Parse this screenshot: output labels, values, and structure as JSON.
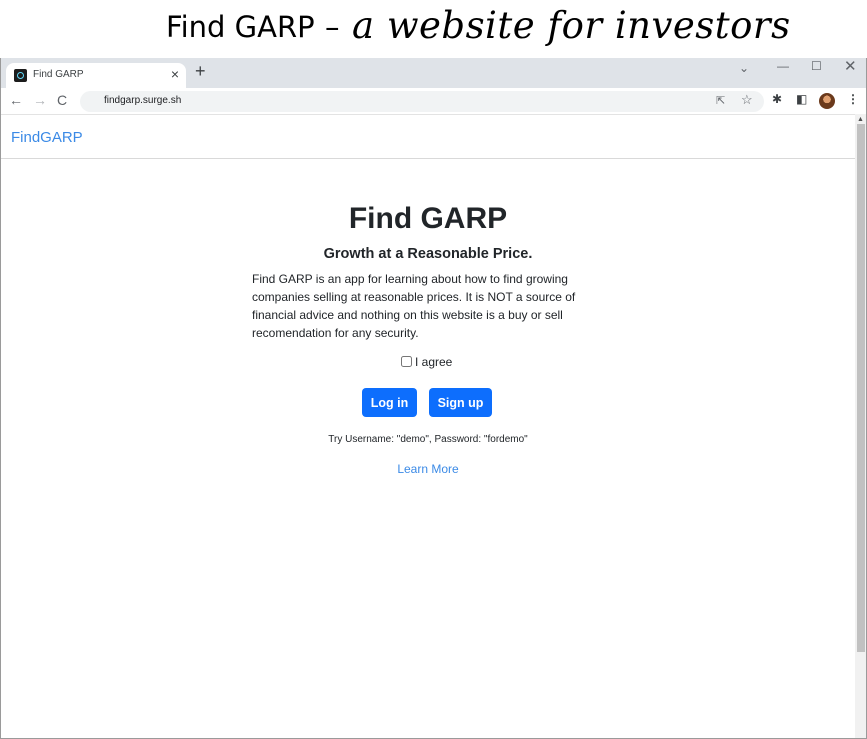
{
  "caption": {
    "plain": "Find GARP",
    "dash": "–",
    "italic": "a website for investors"
  },
  "browser": {
    "tab_title": "Find GARP",
    "tab_close": "×",
    "new_tab": "+",
    "url": "findgarp.surge.sh",
    "icons": {
      "back": "←",
      "forward": "→",
      "reload": "C",
      "share": "⇱",
      "star": "☆",
      "extensions": "✱",
      "sidepanel": "◧",
      "menu": "⋮",
      "chevron": "⌄",
      "minimize": "—",
      "maximize": "☐",
      "close": "✕",
      "scroll_up": "▲"
    }
  },
  "navbar": {
    "brand": "FindGARP"
  },
  "hero": {
    "title": "Find GARP",
    "subtitle": "Growth at a Reasonable Price.",
    "description": "Find GARP is an app for learning about how to find growing companies selling at reasonable prices. It is NOT a source of financial advice and nothing on this website is a buy or sell recomendation for any security.",
    "agree_label": "I agree",
    "agree_checked": false,
    "login_label": "Log in",
    "signup_label": "Sign up",
    "hint": "Try Username: \"demo\", Password: \"fordemo\"",
    "learn_more": "Learn More"
  },
  "colors": {
    "accent": "#0d6efd",
    "link": "#3b8ae6",
    "text": "#212529",
    "tabstrip": "#dfe3e8"
  }
}
